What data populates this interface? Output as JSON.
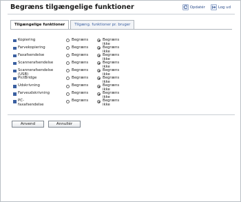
{
  "header": {
    "title": "Begræns tilgængelige funktioner",
    "refresh_label": "Opdatér",
    "logout_label": "Log ud"
  },
  "tabs": [
    {
      "label": "Tilgængelige funktioner",
      "active": true
    },
    {
      "label": "Tilgæng. funktioner pr. bruger",
      "active": false
    }
  ],
  "options": {
    "restrict": "Begræns",
    "no_restrict": "Begræns ikke"
  },
  "functions": [
    {
      "label": "Kopiering",
      "selected": "no_restrict"
    },
    {
      "label": "Farvekopiering",
      "selected": "no_restrict"
    },
    {
      "label": "Faxafsendelse",
      "selected": "no_restrict"
    },
    {
      "label": "Scannerafsendelse",
      "selected": "no_restrict"
    },
    {
      "label": "Scannerafsendelse (USB)",
      "selected": "no_restrict"
    },
    {
      "label": "PictBridge",
      "selected": "no_restrict"
    },
    {
      "label": "Udskrivning",
      "selected": "no_restrict"
    },
    {
      "label": "Farveudskrivning",
      "selected": "no_restrict"
    },
    {
      "label": "PC-faxafsendelse",
      "selected": "no_restrict"
    }
  ],
  "actions": {
    "apply_label": "Anvend",
    "cancel_label": "Annullér"
  },
  "colors": {
    "accent": "#3a5fa0"
  }
}
